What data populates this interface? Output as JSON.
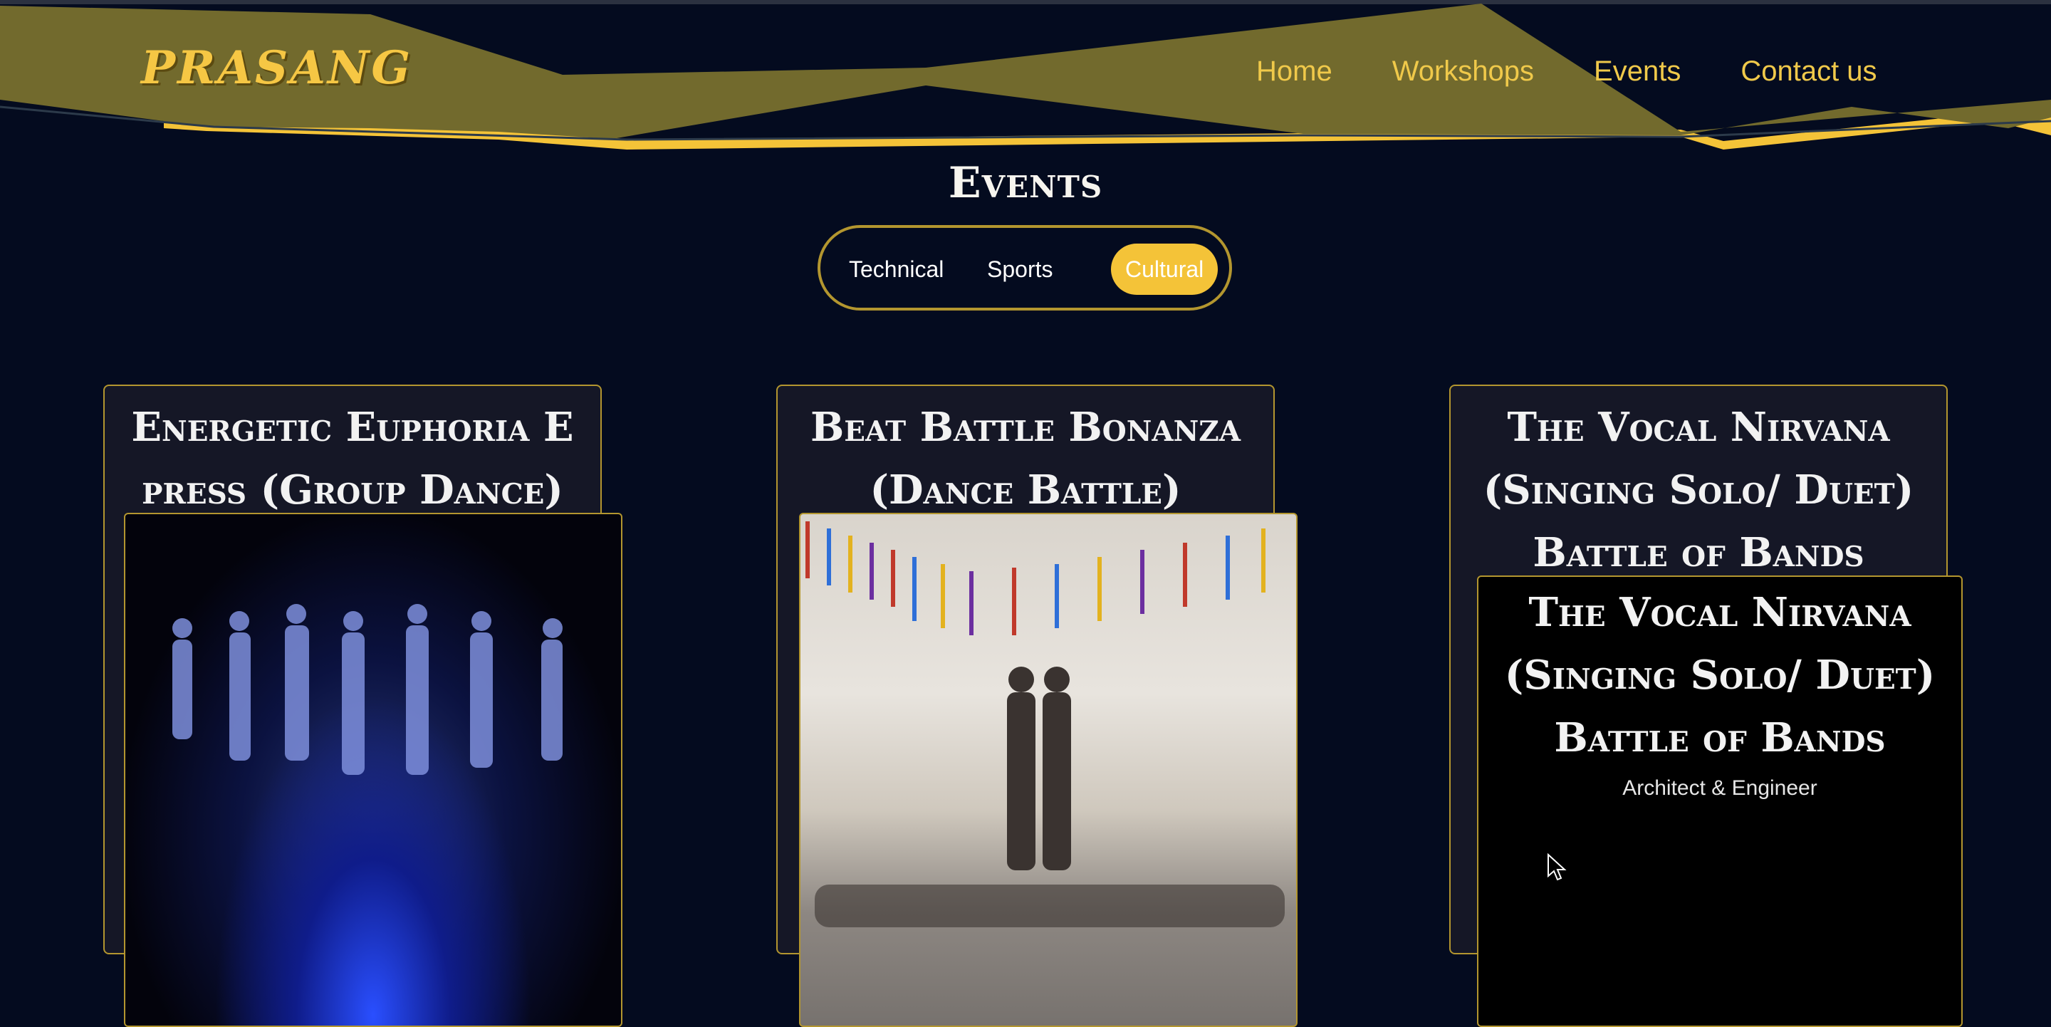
{
  "brand": {
    "name": "PRASANG"
  },
  "colors": {
    "accent": "#f4c338",
    "background": "#040b1f",
    "banner": "#726a2d",
    "border": "#b3962f"
  },
  "nav": [
    {
      "label": "Home"
    },
    {
      "label": "Workshops"
    },
    {
      "label": "Events"
    },
    {
      "label": "Contact us"
    }
  ],
  "page": {
    "title": "Events"
  },
  "tabs": [
    {
      "label": "Technical",
      "active": false
    },
    {
      "label": "Sports",
      "active": false
    },
    {
      "label": "Cultural",
      "active": true
    }
  ],
  "cards": [
    {
      "title": "Energetic Euphoria E  press (Group Dance)",
      "image": "group dance performers under blue stage light"
    },
    {
      "title": "Beat Battle Bonanza (Dance Battle)",
      "image": "dance battle in white room with hanging ribbons"
    },
    {
      "title": "The Vocal Nirvana (Singing Solo/ Duet) Battle of Bands",
      "overlay_title": "The Vocal Nirvana (Singing Solo/ Duet) Battle of Bands",
      "overlay_subtitle": "Architect & Engineer"
    }
  ],
  "icons": {
    "cursor": "mouse-pointer-icon"
  }
}
